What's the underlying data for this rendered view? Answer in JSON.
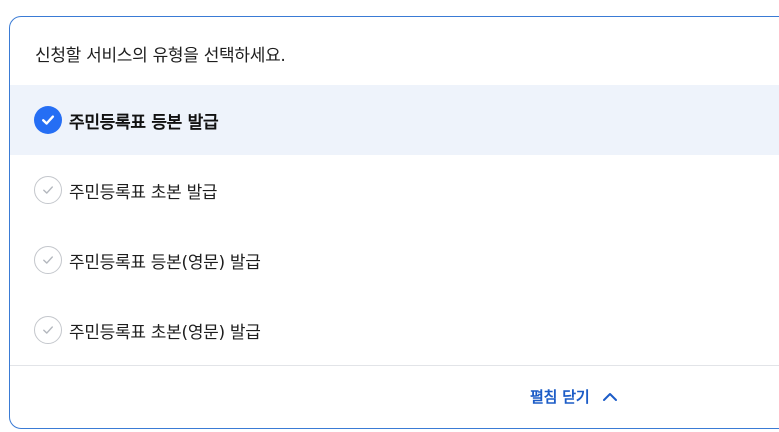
{
  "prompt": "신청할 서비스의 유형을 선택하세요.",
  "options": [
    {
      "label": "주민등록표 등본 발급",
      "selected": true
    },
    {
      "label": "주민등록표 초본 발급",
      "selected": false
    },
    {
      "label": "주민등록표 등본(영문) 발급",
      "selected": false
    },
    {
      "label": "주민등록표 초본(영문) 발급",
      "selected": false
    }
  ],
  "footer": {
    "toggle_label": "펼침 닫기",
    "toggle_icon": "chevron-up-icon"
  },
  "colors": {
    "accent": "#256ef4",
    "accent_text": "#1c5cc7",
    "selected_bg": "#eef3fb",
    "border": "#3a7bd5"
  }
}
